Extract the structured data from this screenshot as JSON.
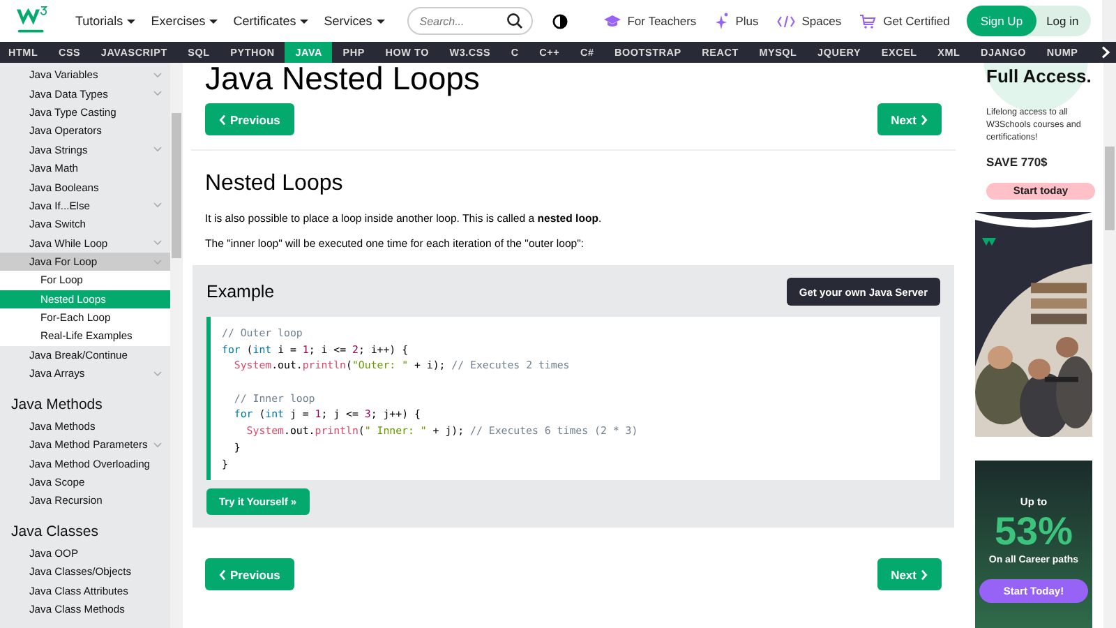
{
  "topbar": {
    "menus": [
      "Tutorials",
      "Exercises",
      "Certificates",
      "Services"
    ],
    "search": {
      "placeholder": "Search..."
    },
    "links": [
      {
        "label": "For Teachers",
        "kind": "teachers"
      },
      {
        "label": "Plus",
        "kind": "plus"
      },
      {
        "label": "Spaces",
        "kind": "spaces"
      },
      {
        "label": "Get Certified",
        "kind": "cart"
      }
    ],
    "signup": "Sign Up",
    "login": "Log in"
  },
  "navbar": {
    "items": [
      {
        "label": "HTML",
        "selected": false
      },
      {
        "label": "CSS",
        "selected": false
      },
      {
        "label": "JAVASCRIPT",
        "selected": false
      },
      {
        "label": "SQL",
        "selected": false
      },
      {
        "label": "PYTHON",
        "selected": false
      },
      {
        "label": "JAVA",
        "selected": true
      },
      {
        "label": "PHP",
        "selected": false
      },
      {
        "label": "HOW TO",
        "selected": false
      },
      {
        "label": "W3.CSS",
        "selected": false
      },
      {
        "label": "C",
        "selected": false
      },
      {
        "label": "C++",
        "selected": false
      },
      {
        "label": "C#",
        "selected": false
      },
      {
        "label": "BOOTSTRAP",
        "selected": false
      },
      {
        "label": "REACT",
        "selected": false
      },
      {
        "label": "MYSQL",
        "selected": false
      },
      {
        "label": "JQUERY",
        "selected": false
      },
      {
        "label": "EXCEL",
        "selected": false
      },
      {
        "label": "XML",
        "selected": false
      },
      {
        "label": "DJANGO",
        "selected": false
      },
      {
        "label": "NUMP",
        "selected": false
      }
    ]
  },
  "sidebar": {
    "sections": [
      {
        "items": [
          {
            "label": "Java Variables",
            "expandable": true,
            "open": false
          },
          {
            "label": "Java Data Types",
            "expandable": true,
            "open": false
          },
          {
            "label": "Java Type Casting",
            "expandable": false,
            "open": false
          },
          {
            "label": "Java Operators",
            "expandable": false,
            "open": false
          },
          {
            "label": "Java Strings",
            "expandable": true,
            "open": false
          },
          {
            "label": "Java Math",
            "expandable": false,
            "open": false
          },
          {
            "label": "Java Booleans",
            "expandable": false,
            "open": false
          },
          {
            "label": "Java If...Else",
            "expandable": true,
            "open": false
          },
          {
            "label": "Java Switch",
            "expandable": false,
            "open": false
          },
          {
            "label": "Java While Loop",
            "expandable": true,
            "open": false
          },
          {
            "label": "Java For Loop",
            "expandable": true,
            "open": true,
            "children": [
              {
                "label": "For Loop",
                "selected": false
              },
              {
                "label": "Nested Loops",
                "selected": true
              },
              {
                "label": "For-Each Loop",
                "selected": false
              },
              {
                "label": "Real-Life Examples",
                "selected": false
              }
            ]
          },
          {
            "label": "Java Break/Continue",
            "expandable": false,
            "open": false
          },
          {
            "label": "Java Arrays",
            "expandable": true,
            "open": false
          }
        ]
      },
      {
        "title": "Java Methods",
        "items": [
          {
            "label": "Java Methods",
            "expandable": false,
            "open": false
          },
          {
            "label": "Java Method Parameters",
            "expandable": true,
            "open": false
          },
          {
            "label": "Java Method Overloading",
            "expandable": false,
            "open": false
          },
          {
            "label": "Java Scope",
            "expandable": false,
            "open": false
          },
          {
            "label": "Java Recursion",
            "expandable": false,
            "open": false
          }
        ]
      },
      {
        "title": "Java Classes",
        "items": [
          {
            "label": "Java OOP",
            "expandable": false,
            "open": false
          },
          {
            "label": "Java Classes/Objects",
            "expandable": false,
            "open": false
          },
          {
            "label": "Java Class Attributes",
            "expandable": false,
            "open": false
          },
          {
            "label": "Java Class Methods",
            "expandable": false,
            "open": false
          }
        ]
      }
    ]
  },
  "main": {
    "title": "Java Nested Loops",
    "previous": "Previous",
    "next": "Next",
    "bottom_previous": "Previous",
    "bottom_next": "Next",
    "heading": "Nested Loops",
    "paragraphs": [
      "It is also possible to place a loop inside another loop. This is called a **nested loop**.",
      "The \"inner loop\" will be executed one time for each iteration of the \"outer loop\":"
    ],
    "example": {
      "title": "Example",
      "server_button": "Get your own Java Server",
      "try_button": "Try it Yourself »",
      "code": [
        {
          "kind": "code",
          "tokens": [
            {
              "kind": "comment",
              "text": "// Outer loop"
            }
          ]
        },
        {
          "kind": "code",
          "tokens": [
            {
              "kind": "keyword",
              "text": "for"
            },
            {
              "kind": "plain",
              "text": " ("
            },
            {
              "kind": "keyword",
              "text": "int"
            },
            {
              "kind": "plain",
              "text": " i = "
            },
            {
              "kind": "number",
              "text": "1"
            },
            {
              "kind": "plain",
              "text": "; i <= "
            },
            {
              "kind": "number",
              "text": "2"
            },
            {
              "kind": "plain",
              "text": "; i++) {"
            }
          ]
        },
        {
          "kind": "code",
          "tokens": [
            {
              "kind": "class",
              "text": "  System"
            },
            {
              "kind": "plain",
              "text": ".out."
            },
            {
              "kind": "class",
              "text": "println"
            },
            {
              "kind": "plain",
              "text": "("
            },
            {
              "kind": "string",
              "text": "\"Outer: \""
            },
            {
              "kind": "plain",
              "text": " + i); "
            },
            {
              "kind": "comment",
              "text": "// Executes 2 times"
            }
          ]
        },
        {
          "kind": "blank"
        },
        {
          "kind": "code",
          "tokens": [
            {
              "kind": "comment",
              "text": "  // Inner loop"
            }
          ]
        },
        {
          "kind": "code",
          "tokens": [
            {
              "kind": "keyword",
              "text": "  for"
            },
            {
              "kind": "plain",
              "text": " ("
            },
            {
              "kind": "keyword",
              "text": "int"
            },
            {
              "kind": "plain",
              "text": " j = "
            },
            {
              "kind": "number",
              "text": "1"
            },
            {
              "kind": "plain",
              "text": "; j <= "
            },
            {
              "kind": "number",
              "text": "3"
            },
            {
              "kind": "plain",
              "text": "; j++) {"
            }
          ]
        },
        {
          "kind": "code",
          "tokens": [
            {
              "kind": "class",
              "text": "    System"
            },
            {
              "kind": "plain",
              "text": ".out."
            },
            {
              "kind": "class",
              "text": "println"
            },
            {
              "kind": "plain",
              "text": "("
            },
            {
              "kind": "string",
              "text": "\" Inner: \""
            },
            {
              "kind": "plain",
              "text": " + j); "
            },
            {
              "kind": "comment",
              "text": "// Executes 6 times (2 * 3)"
            }
          ]
        },
        {
          "kind": "code",
          "tokens": [
            {
              "kind": "plain",
              "text": "  }"
            }
          ]
        },
        {
          "kind": "code",
          "tokens": [
            {
              "kind": "plain",
              "text": "}"
            }
          ]
        }
      ]
    }
  },
  "ads": {
    "promo": {
      "title": "Full Access.",
      "text": "Lifelong access to all W3Schools courses and certifications!",
      "price": "SAVE 770$",
      "button": "Start today"
    },
    "career": {
      "lead": "Up to",
      "percent": "53%",
      "text": "On all Career paths",
      "button": "Start Today!"
    }
  }
}
